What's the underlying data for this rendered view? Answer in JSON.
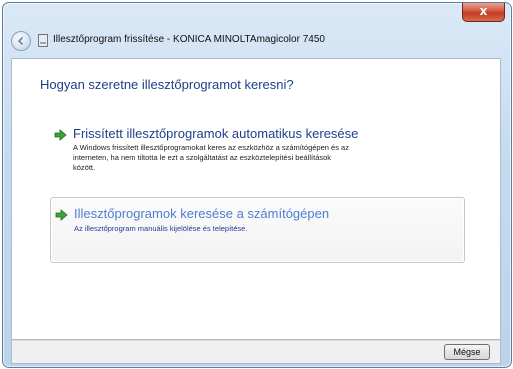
{
  "window": {
    "title": "Illesztőprogram frissítése - KONICA MINOLTAmagicolor 7450",
    "close_label": "x"
  },
  "main": {
    "heading": "Hogyan szeretne illesztőprogramot keresni?",
    "options": [
      {
        "title": "Frissített illesztőprogramok automatikus keresése",
        "description_lines": [
          "A Windows frissített illesztőprogramokat keres az eszközhöz a számítógépen és az",
          "interneten, ha nem tiltotta le ezt a szolgáltatást az eszköztelepítési beállítások",
          "között."
        ],
        "icon": "green-arrow-icon"
      },
      {
        "title": "Illesztőprogramok keresése a számítógépen",
        "description_lines": [
          "Az illesztőprogram manuális kijelölése és telepítése."
        ],
        "icon": "green-arrow-icon"
      }
    ]
  },
  "footer": {
    "cancel_label": "Mégse"
  },
  "colors": {
    "heading": "#1e3f8a",
    "link_hover": "#4c7fd1",
    "close_button": "#c23b22"
  }
}
